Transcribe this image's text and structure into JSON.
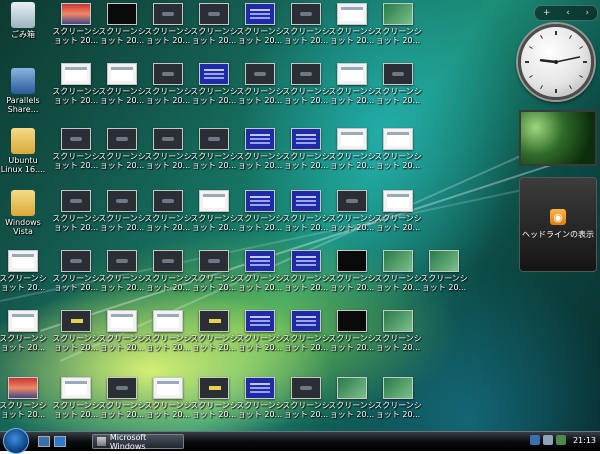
{
  "desktop": {
    "system_icons": [
      {
        "label": "ごみ箱",
        "icon": "recycle-bin-icon"
      },
      {
        "label": "Parallels Share...",
        "icon": "parallels-share-icon"
      },
      {
        "label": "Ubuntu Linux 16....",
        "icon": "folder-icon"
      },
      {
        "label": "Windows Vista",
        "icon": "folder-icon"
      }
    ],
    "screenshot_label_line1": "スクリーンシ",
    "screenshot_label_line2": "ョット 20...",
    "thumbnail_grid": [
      [
        "photo",
        "black",
        "dark",
        "dark",
        "blue",
        "dark",
        "white",
        "green"
      ],
      [
        "white",
        "white",
        "dark",
        "blue",
        "dark",
        "dark",
        "white",
        "dark"
      ],
      [
        "dark",
        "dark",
        "dark",
        "dark",
        "blue",
        "blue",
        "white",
        "white"
      ],
      [
        "dark",
        "dark",
        "dark",
        "white",
        "blue",
        "blue",
        "dark",
        "white"
      ],
      [
        "dark",
        "dark",
        "dark",
        "dark",
        "blue",
        "blue",
        "black",
        "green",
        "green"
      ],
      [
        "yellow",
        "white",
        "white",
        "yellow",
        "blue",
        "blue",
        "black",
        "green"
      ],
      [
        "white",
        "dark",
        "white",
        "yellow",
        "blue",
        "dark",
        "green",
        "green"
      ]
    ],
    "first_col_thumbs": [
      "white",
      "white",
      "photo"
    ]
  },
  "sidebar": {
    "controls": [
      "+",
      "‹",
      "›"
    ],
    "clock": {
      "hour": 9,
      "minute": 13
    },
    "feed_label": "ヘッドラインの表示"
  },
  "taskbar": {
    "start_icon": "windows-start-icon",
    "task_label": "Microsoft Windows",
    "time": "21:13"
  },
  "colors": {
    "accent": "#1f2aa6",
    "taskbar": "#0c0d10"
  }
}
